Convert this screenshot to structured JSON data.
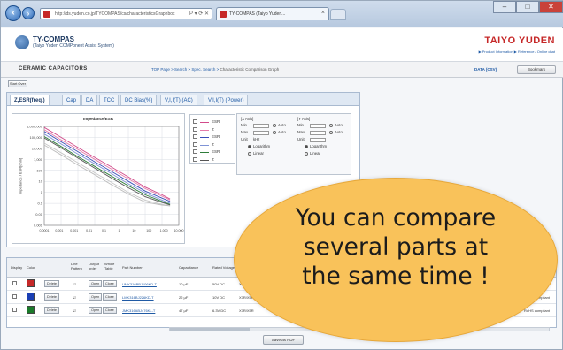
{
  "browser": {
    "address_text": "http://ds.yuden.co.jp/TYCOMPAS/cs/characteristicsGraphbox",
    "address_controls": "P ▾ ⟳ ✕",
    "tab_title": "TY-COMPAS (Taiyo Yuden...",
    "tab_close": "×",
    "window_min": "–",
    "window_max": "□",
    "window_close": "✕"
  },
  "header": {
    "app_title": "TY-COMPAS",
    "app_subtitle": "(Taiyo Yuden COMPonent Assist System)",
    "brand": "TAIYO YUDEN",
    "links": "▶ Product Information   ▶ Reference / Online chat"
  },
  "crumbs": {
    "section_title": "CERAMIC CAPACITORS",
    "trail": "TOP Page > Search > Spec. Search > ",
    "current": "Characteristic Comparison Graph",
    "csv_link": "DATA (CSV)",
    "bookmark_btn": "Bookmark"
  },
  "start_over": "Start Over",
  "tabs": [
    "Z,ESR(freq.)",
    "Cap",
    "DA",
    "TCC",
    "DC Bias(%)",
    "V,I,I(T) (AC)",
    "V,I,I(T) (Power)"
  ],
  "chart_data": {
    "type": "line",
    "title": "Impedance/ESR",
    "ylabel": "Impedance / ESR[ohm]",
    "xlabel": "",
    "x_ticks": [
      "0.0001",
      "0.001",
      "0.001",
      "0.01",
      "0.1",
      "1",
      "10",
      "100",
      "1,000",
      "10,000"
    ],
    "y_ticks": [
      "1,000,000",
      "100,000",
      "10,000",
      "1,000",
      "100",
      "10",
      "1",
      "0.1",
      "0.01",
      "0.001"
    ],
    "grid": true,
    "series": [
      {
        "color": "#d24a8a",
        "points": [
          [
            0.0001,
            800000
          ],
          [
            0.001,
            100000
          ],
          [
            0.01,
            12000
          ],
          [
            0.1,
            1500
          ],
          [
            1,
            200
          ],
          [
            10,
            25
          ],
          [
            100,
            3
          ],
          [
            1000,
            0.6
          ],
          [
            3000,
            0.25
          ]
        ]
      },
      {
        "color": "#e57ba9",
        "points": [
          [
            0.0001,
            500000
          ],
          [
            0.001,
            60000
          ],
          [
            0.01,
            8000
          ],
          [
            0.1,
            1000
          ],
          [
            1,
            130
          ],
          [
            10,
            17
          ],
          [
            100,
            2.2
          ],
          [
            1000,
            0.45
          ],
          [
            3000,
            0.2
          ]
        ]
      },
      {
        "color": "#3a4fb8",
        "points": [
          [
            0.0001,
            350000
          ],
          [
            0.001,
            40000
          ],
          [
            0.01,
            5000
          ],
          [
            0.1,
            600
          ],
          [
            1,
            80
          ],
          [
            10,
            10
          ],
          [
            100,
            1.3
          ],
          [
            1000,
            0.3
          ],
          [
            3000,
            0.15
          ]
        ]
      },
      {
        "color": "#7f93d6",
        "points": [
          [
            0.0001,
            200000
          ],
          [
            0.001,
            25000
          ],
          [
            0.01,
            3000
          ],
          [
            0.1,
            400
          ],
          [
            1,
            50
          ],
          [
            10,
            6
          ],
          [
            100,
            0.9
          ],
          [
            1000,
            0.2
          ],
          [
            3000,
            0.1
          ]
        ]
      },
      {
        "color": "#2f7d3a",
        "points": [
          [
            0.0001,
            120000
          ],
          [
            0.001,
            15000
          ],
          [
            0.01,
            1800
          ],
          [
            0.1,
            230
          ],
          [
            1,
            30
          ],
          [
            10,
            4
          ],
          [
            100,
            0.6
          ],
          [
            1000,
            0.15
          ],
          [
            3000,
            0.08
          ]
        ]
      },
      {
        "color": "#555555",
        "points": [
          [
            0.0001,
            90000
          ],
          [
            0.001,
            11000
          ],
          [
            0.01,
            1300
          ],
          [
            0.1,
            160
          ],
          [
            1,
            20
          ],
          [
            10,
            2.6
          ],
          [
            100,
            0.4
          ],
          [
            1000,
            0.12
          ],
          [
            3000,
            0.07
          ]
        ]
      },
      {
        "color": "#c7c7c7",
        "points": [
          [
            0.0001,
            30000
          ],
          [
            0.001,
            4000
          ],
          [
            0.01,
            500
          ],
          [
            0.1,
            60
          ],
          [
            1,
            8
          ],
          [
            10,
            1
          ],
          [
            100,
            0.2
          ],
          [
            1000,
            0.08
          ],
          [
            3000,
            0.06
          ]
        ]
      },
      {
        "color": "#bdbdbd",
        "points": [
          [
            0.0001,
            20000
          ],
          [
            0.001,
            2600
          ],
          [
            0.01,
            300
          ],
          [
            0.1,
            40
          ],
          [
            1,
            5
          ],
          [
            10,
            0.7
          ],
          [
            100,
            0.13
          ],
          [
            1000,
            0.07
          ],
          [
            3000,
            0.06
          ]
        ]
      }
    ],
    "ylim": [
      0.001,
      1000000
    ],
    "xlim": [
      0.0001,
      10000
    ],
    "x_scale": "log",
    "y_scale": "log"
  },
  "legend": [
    {
      "color": "#d24a8a",
      "label": "ESR"
    },
    {
      "color": "#e57ba9",
      "label": "Z"
    },
    {
      "color": "#3a4fb8",
      "label": "ESR"
    },
    {
      "color": "#7f93d6",
      "label": "Z"
    },
    {
      "color": "#2f7d3a",
      "label": "ESR"
    },
    {
      "color": "#555555",
      "label": "Z"
    }
  ],
  "axis_settings": {
    "x": {
      "title": "[X Axis]",
      "min": "Min",
      "max": "Max",
      "unit": "Unit",
      "unit_val": "kHz",
      "auto": "Auto",
      "log": "Logarithm",
      "linear": "Linear"
    },
    "y": {
      "title": "[Y Axis]",
      "min": "Min",
      "max": "Max",
      "unit": "Unit",
      "auto": "Auto",
      "log": "Logarithm",
      "linear": "Linear"
    }
  },
  "table": {
    "headers": [
      "Display",
      "Color",
      "",
      "Line Pattern",
      "Output order",
      "Whole Table",
      "Part Number",
      "Capacitance",
      "Rated Voltage",
      "",
      "",
      "",
      "",
      "RoHS"
    ],
    "rows": [
      {
        "color": "#c62828",
        "delete": "Delete",
        "chk": "☑",
        "open": "Open",
        "close": "Close",
        "part": "UMK316BBJ106KD-T",
        "cap": "10 µF",
        "volt": "50V DC",
        "rohs": "RoHS compliant"
      },
      {
        "color": "#1a3fb4",
        "delete": "Delete",
        "chk": "☑",
        "open": "Open",
        "close": "Close",
        "part": "LMK316BJ226KD-T",
        "cap": "22 µF",
        "volt": "10V DC",
        "rohs": "RoHS compliant"
      },
      {
        "color": "#1b7a2a",
        "delete": "Delete",
        "chk": "☑",
        "open": "Open",
        "close": "Close",
        "part": "JMK316ABJ476KL-T",
        "cap": "47 µF",
        "volt": "6.3V DC",
        "rohs": "RoHS compliant"
      }
    ],
    "row_note": "X7R/X5R"
  },
  "save_btn": "Save as PDF",
  "callout": {
    "line1": "You can compare",
    "line2": "several parts at",
    "line3": "the same time !"
  }
}
